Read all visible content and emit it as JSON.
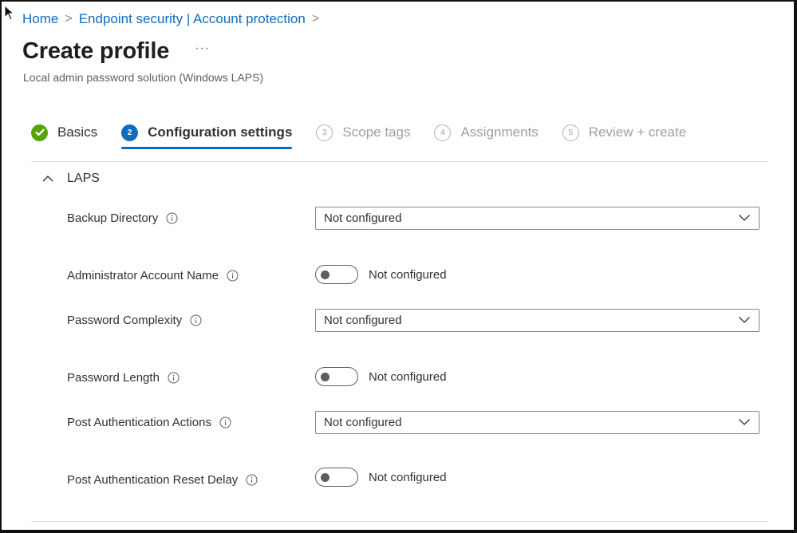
{
  "breadcrumb": {
    "items": [
      "Home",
      "Endpoint security | Account protection"
    ],
    "separator": ">"
  },
  "page": {
    "title": "Create profile",
    "more_label": "···",
    "subtitle": "Local admin password solution (Windows LAPS)"
  },
  "wizard": {
    "steps": [
      {
        "number": "✓",
        "label": "Basics",
        "state": "done"
      },
      {
        "number": "2",
        "label": "Configuration settings",
        "state": "active"
      },
      {
        "number": "3",
        "label": "Scope tags",
        "state": "pending"
      },
      {
        "number": "4",
        "label": "Assignments",
        "state": "pending"
      },
      {
        "number": "5",
        "label": "Review + create",
        "state": "pending"
      }
    ]
  },
  "section": {
    "title": "LAPS",
    "expanded": true,
    "settings": [
      {
        "label": "Backup Directory",
        "type": "dropdown",
        "value": "Not configured"
      },
      {
        "label": "Administrator Account Name",
        "type": "toggle",
        "value": "Not configured",
        "on": false
      },
      {
        "label": "Password Complexity",
        "type": "dropdown",
        "value": "Not configured"
      },
      {
        "label": "Password Length",
        "type": "toggle",
        "value": "Not configured",
        "on": false
      },
      {
        "label": "Post Authentication Actions",
        "type": "dropdown",
        "value": "Not configured"
      },
      {
        "label": "Post Authentication Reset Delay",
        "type": "toggle",
        "value": "Not configured",
        "on": false
      }
    ]
  },
  "colors": {
    "link": "#0f6cbd",
    "accent": "#0f6cbd",
    "success": "#57a300",
    "text": "#323130",
    "muted": "#a19f9d"
  }
}
